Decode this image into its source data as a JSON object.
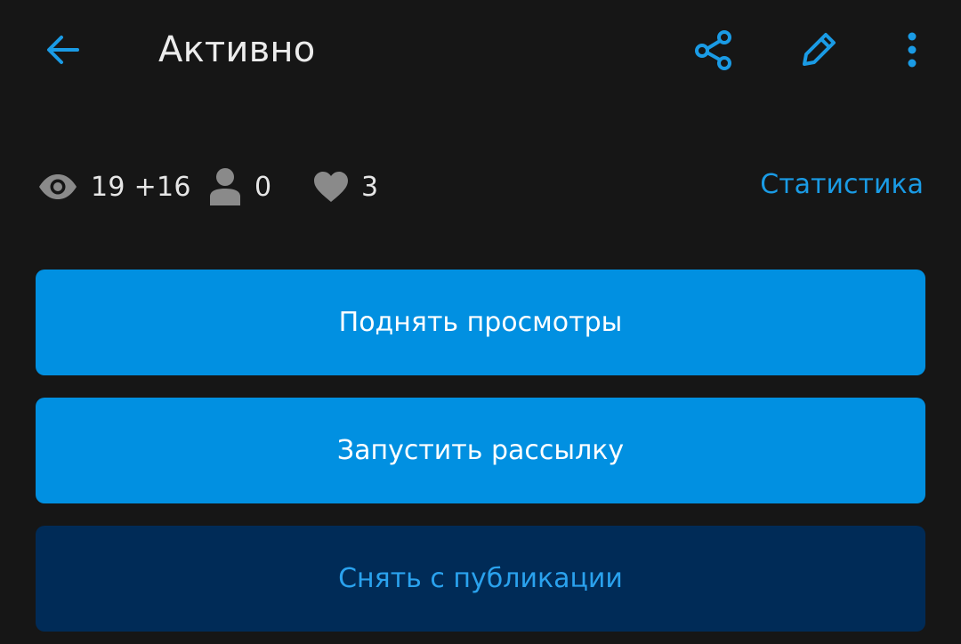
{
  "header": {
    "title": "Активно",
    "back_icon": "arrow-left-icon",
    "share_icon": "share-icon",
    "edit_icon": "pencil-icon",
    "more_icon": "more-vertical-icon"
  },
  "stats": {
    "views": "19 +16",
    "contacts": "0",
    "favorites": "3",
    "statistics_link": "Статистика"
  },
  "actions": {
    "boost_label": "Поднять просмотры",
    "mailing_label": "Запустить рассылку",
    "unpublish_label": "Снять с публикации"
  },
  "colors": {
    "background": "#161616",
    "accent": "#0190e1",
    "accent_text": "#1a9be5",
    "dark_button": "#002b57",
    "icon_gray": "#8a8a8a"
  }
}
